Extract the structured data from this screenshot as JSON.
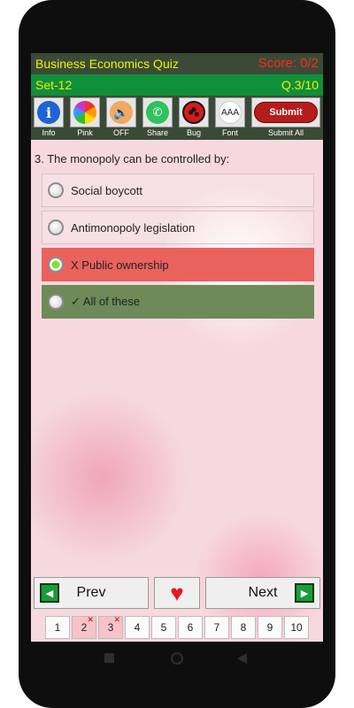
{
  "header": {
    "title": "Business Economics Quiz",
    "score": "Score: 0/2",
    "set": "Set-12",
    "question_number": "Q.3/10"
  },
  "toolbar": {
    "info_label": "Info",
    "pink_label": "Pink",
    "off_label": "OFF",
    "share_label": "Share",
    "bug_label": "Bug",
    "font_label": "Font",
    "submit_all_label": "Submit All",
    "submit_button": "Submit",
    "font_icon_text": "AAA"
  },
  "question": "3. The monopoly can be controlled by:",
  "options": [
    {
      "text": "Social boycott",
      "state": "none"
    },
    {
      "text": "Antimonopoly legislation",
      "state": "none"
    },
    {
      "text": "X Public ownership",
      "state": "wrong-selected"
    },
    {
      "text": "✓ All of these",
      "state": "correct"
    }
  ],
  "nav": {
    "prev": "Prev",
    "next": "Next"
  },
  "pager": [
    {
      "label": "1",
      "wrong": false
    },
    {
      "label": "2",
      "wrong": true
    },
    {
      "label": "3",
      "wrong": true
    },
    {
      "label": "4",
      "wrong": false
    },
    {
      "label": "5",
      "wrong": false
    },
    {
      "label": "6",
      "wrong": false
    },
    {
      "label": "7",
      "wrong": false
    },
    {
      "label": "8",
      "wrong": false
    },
    {
      "label": "9",
      "wrong": false
    },
    {
      "label": "10",
      "wrong": false
    }
  ],
  "colors": {
    "header_dark": "#3b4a37",
    "header_green": "#0f8f3a",
    "header_text": "#f0f000",
    "score_red": "#ff2a1a",
    "wrong_option": "#e9625e",
    "correct_option": "#6d8a58",
    "submit_red": "#b31d1d"
  }
}
